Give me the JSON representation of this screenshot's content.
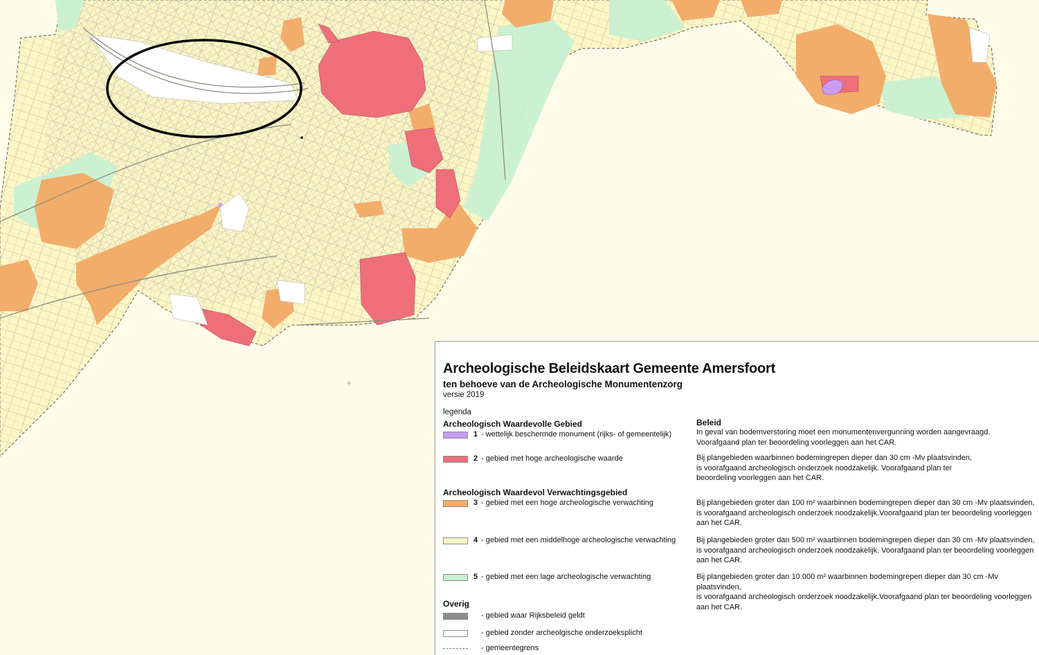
{
  "map": {
    "colors": {
      "background": "#fffbe9",
      "category_1": "#c99cf2",
      "category_2": "#ee6f7a",
      "category_3": "#f2ad6b",
      "category_4": "#fdf6c5",
      "category_5": "#c8f0d2",
      "rijksbeleid": "#8c8c8c",
      "geen_onderzoeksplicht": "#ffffff",
      "streets": "#b9b7a8",
      "highlight_ellipse": "#000000"
    },
    "annotation": "ellipse highlighting railway area"
  },
  "legend": {
    "title": "Archeologische Beleidskaart Gemeente Amersfoort",
    "subtitle": "ten behoeve van de Archeologische Monumentenzorg",
    "version": "versie 2019",
    "legend_label": "legenda",
    "beleid_header": "Beleid",
    "section1": "Archeologisch Waardevolle Gebied",
    "section2": "Archeologisch Waardevol Verwachtingsgebied",
    "section3": "Overig",
    "items": [
      {
        "num": "1",
        "label": "- wettelijk beschermde monument (rijks- of gemeentelijk)",
        "color": "#c99cf2",
        "policy": "In geval van bodemverstoring moet een monumentenvergunning worden aangevraagd.\nVoorafgaand plan ter beoordeling voorleggen aan het CAR."
      },
      {
        "num": "2",
        "label": "- gebied met hoge archeologische waarde",
        "color": "#ee6f7a",
        "policy": "Bij plangebieden waarbinnen bodemingrepen dieper dan 30 cm -Mv plaatsvinden,\nis voorafgaand archeologisch onderzoek noodzakelijk. Voorafgaand plan ter\nbeoordeling voorleggen aan het CAR."
      },
      {
        "num": "3",
        "label": "- gebied met een hoge archeologische verwachting",
        "color": "#f2ad6b",
        "policy": "Bij plangebieden groter dan 100 m² waarbinnen bodemingrepen dieper dan 30 cm -Mv plaatsvinden,\nis voorafgaand archeologisch onderzoek noodzakelijk.Voorafgaand plan ter beoordeling voorleggen\naan het CAR."
      },
      {
        "num": "4",
        "label": "- gebied met een middelhoge archeologische verwachting",
        "color": "#fdf6c5",
        "policy": "Bij plangebieden groter dan 500 m² waarbinnen bodemingrepen dieper dan 30 cm -Mv plaatsvinden,\nis voorafgaand archeologisch onderzoek noodzakelijk. Voorafgaand plan ter beoordeling voorleggen\naan het CAR."
      },
      {
        "num": "5",
        "label": "- gebied met een lage archeologische verwachting",
        "color": "#c8f0d2",
        "policy": "Bij plangebieden groter dan 10.000 m² waarbinnen bodemingrepen dieper dan 30 cm -Mv plaatsvinden,\nis voorafgaand archeologisch onderzoek noodzakelijk.Voorafgaand plan ter beoordeling voorleggen\naan het CAR."
      }
    ],
    "other": [
      {
        "label": "- gebied waar Rijksbeleid geldt",
        "color": "#8c8c8c"
      },
      {
        "label": "- gebied zonder archeolgische onderzoeksplicht",
        "color": "#ffffff"
      },
      {
        "label": "- gemeentegrens"
      }
    ]
  }
}
